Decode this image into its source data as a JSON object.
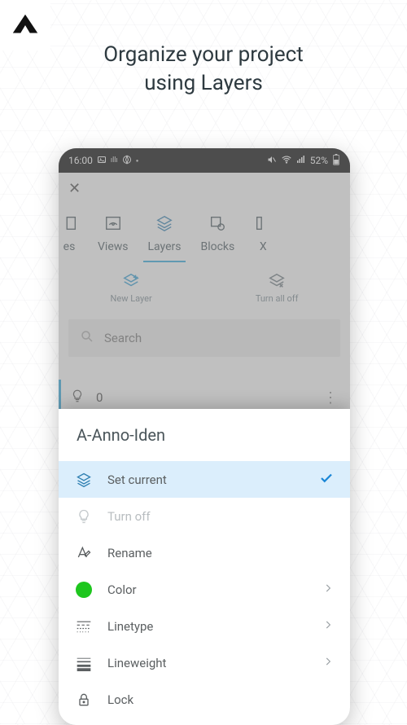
{
  "headline_line1": "Organize your project",
  "headline_line2": "using Layers",
  "status": {
    "time": "16:00",
    "battery_text": "52%"
  },
  "tabs": {
    "left_truncated": "es",
    "views": "Views",
    "layers": "Layers",
    "blocks": "Blocks",
    "right_truncated": "X"
  },
  "tools": {
    "new_layer": "New Layer",
    "turn_all_off": "Turn all off"
  },
  "search": {
    "placeholder": "Search"
  },
  "first_layer": {
    "name": "0"
  },
  "sheet": {
    "title": "A-Anno-Iden",
    "items": {
      "set_current": "Set current",
      "turn_off": "Turn off",
      "rename": "Rename",
      "color": "Color",
      "linetype": "Linetype",
      "lineweight": "Lineweight",
      "lock": "Lock"
    },
    "color_value": "#1ec61e"
  }
}
